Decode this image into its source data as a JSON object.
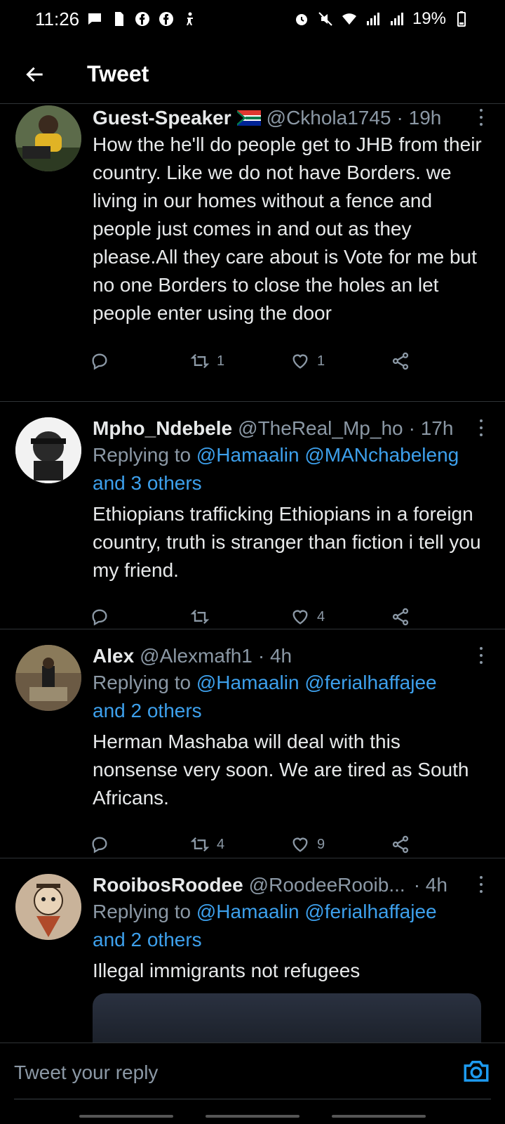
{
  "status_bar": {
    "time": "11:26",
    "battery": "19%",
    "icons": [
      "message-icon",
      "sim-icon",
      "facebook-icon",
      "facebook-icon",
      "accessibility-icon",
      "alarm-icon",
      "mute-icon",
      "wifi-icon",
      "signal-icon",
      "signal-icon",
      "battery-icon"
    ]
  },
  "header": {
    "title": "Tweet",
    "back_icon": "arrow-left-icon"
  },
  "tweets": [
    {
      "name": "Guest-Speaker",
      "flag": "south-africa-flag",
      "handle": "@Ckhola1745",
      "time": "· 19h",
      "reply_prefix": "",
      "mentions": "",
      "others": "",
      "text": "How the he'll do people get to JHB from their country. Like we do not have Borders. we living in our homes without a fence and people just comes in and out as they please.All they care about is Vote for me but no one Borders to close the holes an let people enter using the door",
      "retweets": "1",
      "likes": "1"
    },
    {
      "name": "Mpho_Ndebele",
      "handle": "@TheReal_Mp_ho",
      "time": "· 17h",
      "reply_prefix": "Replying to",
      "mentions": "@Hamaalin @MANchabeleng",
      "others": "and 3 others",
      "text": "Ethiopians trafficking Ethiopians in a foreign country, truth is stranger than fiction i tell you my friend.",
      "retweets": "",
      "likes": "4"
    },
    {
      "name": "Alex",
      "handle": "@Alexmafh1",
      "time": "· 4h",
      "reply_prefix": "Replying to",
      "mentions": "@Hamaalin @ferialhaffajee",
      "others": "and 2 others",
      "text": "Herman Mashaba will deal with this nonsense very soon. We are tired as South Africans.",
      "retweets": "4",
      "likes": "9"
    },
    {
      "name": "RooibosRoodee",
      "handle": "@RoodeeRooib...",
      "time": "· 4h",
      "reply_prefix": "Replying to",
      "mentions": "@Hamaalin @ferialhaffajee",
      "others": "and 2 others",
      "text": "Illegal immigrants not refugees"
    }
  ],
  "reply_bar": {
    "placeholder": "Tweet your reply",
    "camera_icon": "camera-icon"
  },
  "colors": {
    "background": "#000000",
    "accent": "#1d9bf0",
    "secondary_text": "#8b98a5",
    "divider": "#2f3336"
  }
}
